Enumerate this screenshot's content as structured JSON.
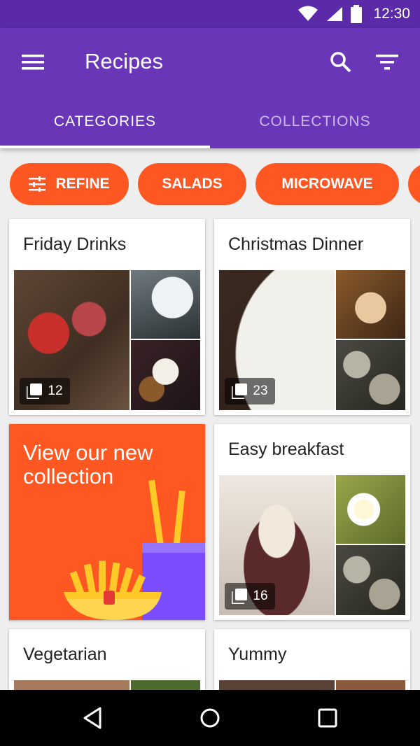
{
  "status_bar": {
    "time": "12:30",
    "icons": [
      "wifi-icon",
      "signal-icon",
      "battery-icon"
    ]
  },
  "app_bar": {
    "title": "Recipes",
    "icons": [
      "menu-icon",
      "search-icon",
      "filter-icon"
    ]
  },
  "tabs": [
    {
      "label": "CATEGORIES",
      "selected": true
    },
    {
      "label": "COLLECTIONS",
      "selected": false
    }
  ],
  "chips": [
    {
      "label": "REFINE",
      "icon": "tune-icon"
    },
    {
      "label": "SALADS"
    },
    {
      "label": "MICROWAVE"
    }
  ],
  "collections": [
    {
      "title": "Friday Drinks",
      "count": "12"
    },
    {
      "title": "Christmas Dinner",
      "count": "23"
    },
    {
      "title": "Easy breakfast",
      "count": "16"
    },
    {
      "title": "Vegetarian"
    },
    {
      "title": "Yummy"
    }
  ],
  "promo": {
    "text": "View our new collection"
  },
  "colors": {
    "primary": "#6a36b8",
    "primary_dark": "#5a2aa8",
    "accent": "#ff5722"
  },
  "nav_bar": {
    "icons": [
      "back-icon",
      "home-icon",
      "recents-icon"
    ]
  }
}
